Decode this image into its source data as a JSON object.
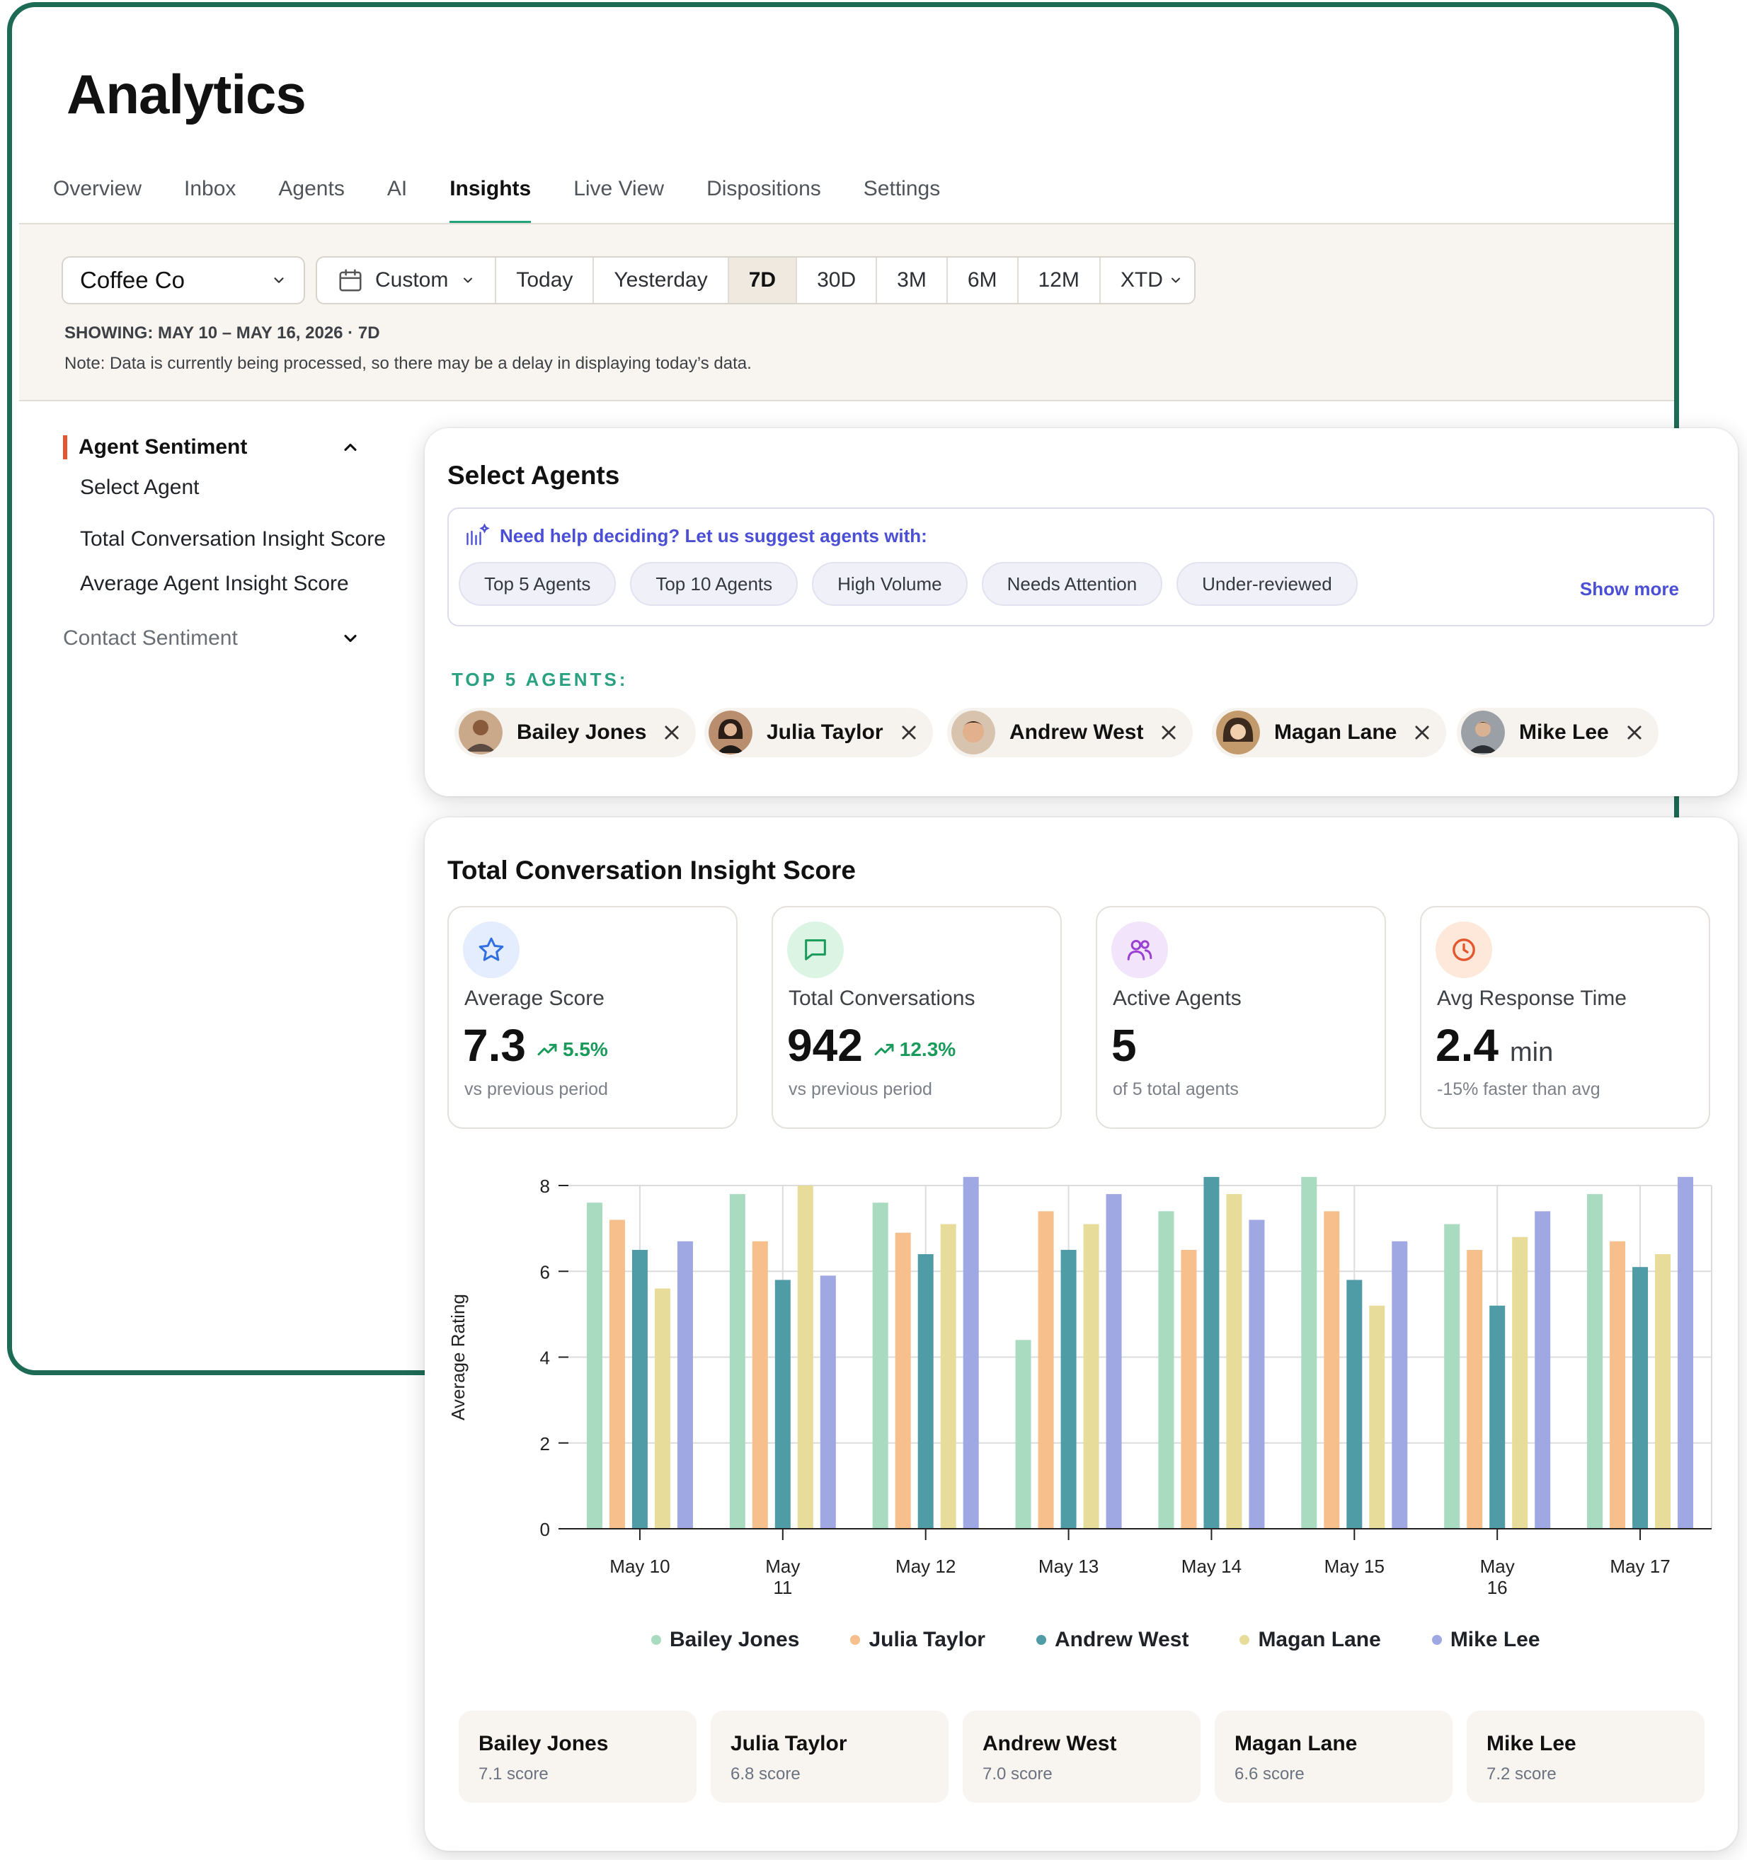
{
  "app": {
    "title": "Analytics",
    "tabs": [
      "Overview",
      "Inbox",
      "Agents",
      "AI",
      "Insights",
      "Live View",
      "Dispositions",
      "Settings"
    ],
    "active_tab": "Insights"
  },
  "filters": {
    "company": "Coffee Co",
    "custom_label": "Custom",
    "ranges": [
      "Today",
      "Yesterday",
      "7D",
      "30D",
      "3M",
      "6M",
      "12M"
    ],
    "xtd_label": "XTD",
    "active_range": "7D",
    "showing": "SHOWING: MAY 10 – MAY 16, 2026 · 7D",
    "note": "Note: Data is currently being processed, so there may be a delay in displaying today’s data."
  },
  "sidebar": {
    "section1": "Agent Sentiment",
    "items": [
      "Select Agent",
      "Total Conversation Insight Score",
      "Average Agent Insight Score"
    ],
    "section2": "Contact Sentiment"
  },
  "select_agents": {
    "title": "Select Agents",
    "suggest_label": "Need help deciding? Let us suggest agents with:",
    "chips": [
      "Top 5 Agents",
      "Top 10 Agents",
      "High Volume",
      "Needs Attention",
      "Under-reviewed"
    ],
    "show_more": "Show more",
    "top5_label": "TOP 5 AGENTS:",
    "agents": [
      "Bailey Jones",
      "Julia Taylor",
      "Andrew West",
      "Magan Lane",
      "Mike Lee"
    ]
  },
  "insight": {
    "title": "Total Conversation Insight Score",
    "stats": {
      "avg_score": {
        "label": "Average Score",
        "value": "7.3",
        "change": "5.5%",
        "sub": "vs previous period",
        "icon": "star-icon"
      },
      "total_conv": {
        "label": "Total Conversations",
        "value": "942",
        "change": "12.3%",
        "sub": "vs previous period",
        "icon": "message-icon"
      },
      "active_agents": {
        "label": "Active Agents",
        "value": "5",
        "sub": "of 5 total agents",
        "icon": "users-icon"
      },
      "avg_response": {
        "label": "Avg Response Time",
        "value": "2.4",
        "unit": "min",
        "sub": "-15% faster than avg",
        "icon": "clock-icon"
      }
    },
    "score_cards": [
      {
        "name": "Bailey Jones",
        "score": "7.1 score"
      },
      {
        "name": "Julia Taylor",
        "score": "6.8 score"
      },
      {
        "name": "Andrew West",
        "score": "7.0 score"
      },
      {
        "name": "Magan Lane",
        "score": "6.6 score"
      },
      {
        "name": "Mike Lee",
        "score": "7.2 score"
      }
    ]
  },
  "colors": {
    "brand": "#1e6b55",
    "accent_tab": "#1fa47b",
    "suggest": "#4b4fd6",
    "positive": "#1a9a5b",
    "series": [
      "#a8dbbf",
      "#f7bf8c",
      "#4f9ba6",
      "#e8dc9a",
      "#a0a8e4"
    ]
  },
  "chart_data": {
    "type": "bar",
    "ylabel": "Average Rating",
    "xlabel": "",
    "ylim": [
      0,
      8
    ],
    "yticks": [
      0,
      2,
      4,
      6,
      8
    ],
    "grid": true,
    "legend_position": "bottom",
    "categories": [
      "May 10",
      "May 11",
      "May 12",
      "May 13",
      "May 14",
      "May 15",
      "May 16",
      "May 17"
    ],
    "series": [
      {
        "name": "Bailey Jones",
        "values": [
          7.6,
          7.8,
          7.6,
          4.4,
          7.4,
          8.2,
          7.1,
          7.8
        ]
      },
      {
        "name": "Julia Taylor",
        "values": [
          7.2,
          6.7,
          6.9,
          7.4,
          6.5,
          7.4,
          6.5,
          6.7
        ]
      },
      {
        "name": "Andrew West",
        "values": [
          6.5,
          5.8,
          6.4,
          6.5,
          8.2,
          5.8,
          5.2,
          6.1
        ]
      },
      {
        "name": "Magan Lane",
        "values": [
          5.6,
          8.0,
          7.1,
          7.1,
          7.8,
          5.2,
          6.8,
          6.4
        ]
      },
      {
        "name": "Mike Lee",
        "values": [
          6.7,
          5.9,
          8.2,
          7.8,
          7.2,
          6.7,
          7.4,
          8.2
        ]
      }
    ]
  }
}
